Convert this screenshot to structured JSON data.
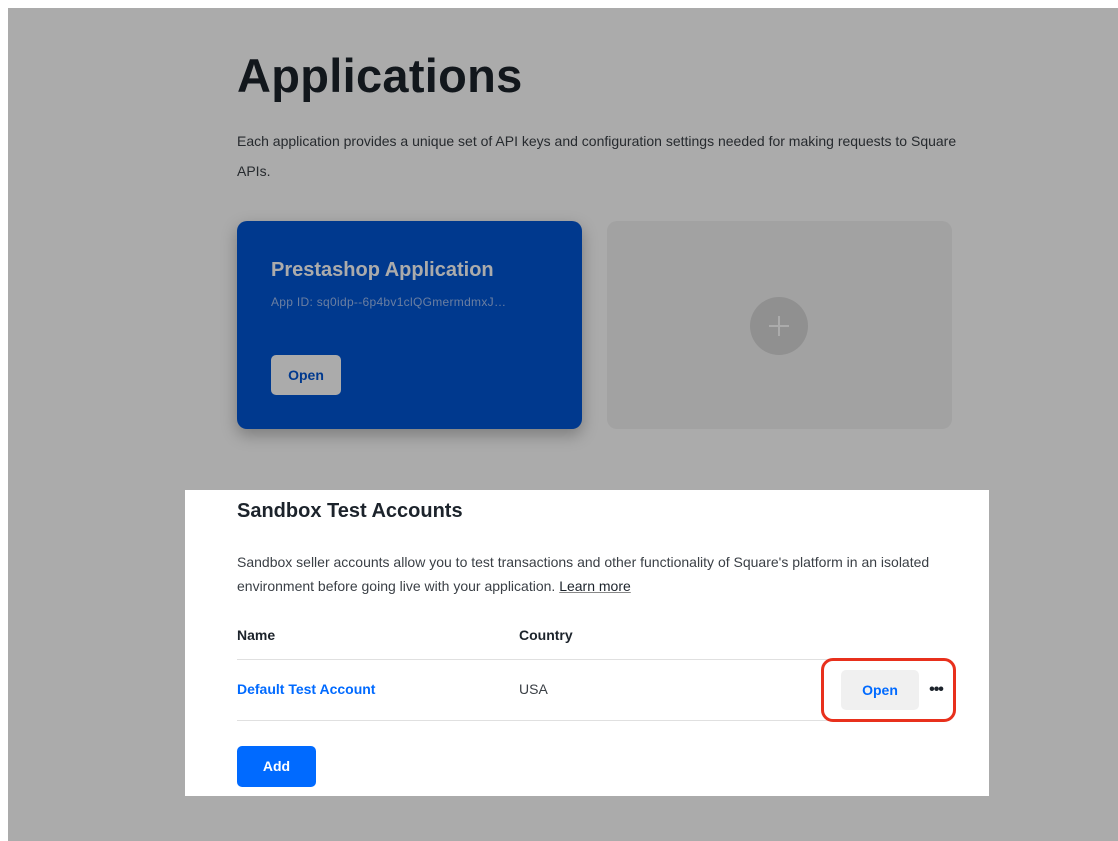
{
  "applications": {
    "title": "Applications",
    "intro": "Each application provides a unique set of API keys and configuration settings needed for making requests to Square APIs.",
    "app_card": {
      "name": "Prestashop Application",
      "app_id": "App ID: sq0idp--6p4bv1clQGmermdmxJ…",
      "open_label": "Open"
    },
    "new_card": {
      "icon": "plus-icon"
    }
  },
  "sandbox": {
    "title": "Sandbox Test Accounts",
    "description": "Sandbox seller accounts allow you to test transactions and other functionality of Square's platform in an isolated environment before going live with your application.",
    "learn_more": "Learn more",
    "columns": {
      "name": "Name",
      "country": "Country"
    },
    "rows": [
      {
        "name": "Default Test Account",
        "country": "USA",
        "open_label": "Open",
        "more_label": "•••"
      }
    ],
    "add_label": "Add"
  },
  "colors": {
    "card_blue": "#0055d4",
    "link_blue": "#006aff",
    "highlight_red": "#e8301c",
    "dim_overlay": "rgba(0,0,0,0.33)"
  }
}
